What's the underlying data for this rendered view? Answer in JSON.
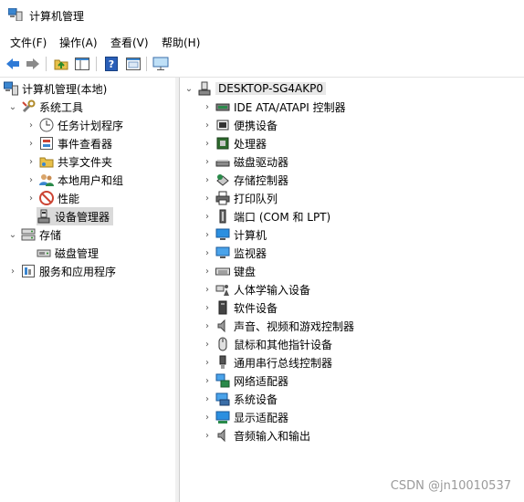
{
  "window": {
    "title": "计算机管理"
  },
  "menu": [
    "文件(F)",
    "操作(A)",
    "查看(V)",
    "帮助(H)"
  ],
  "toolbar": {
    "buttons": [
      "back-icon",
      "forward-icon",
      "up-folder-icon",
      "show-hide-tree-icon",
      "help-icon",
      "properties-icon",
      "monitor-icon"
    ]
  },
  "left_tree": {
    "root": "计算机管理(本地)",
    "system_tools": "系统工具",
    "task_scheduler": "任务计划程序",
    "event_viewer": "事件查看器",
    "shared_folders": "共享文件夹",
    "local_users": "本地用户和组",
    "performance": "性能",
    "device_manager": "设备管理器",
    "storage": "存储",
    "disk_management": "磁盘管理",
    "services_apps": "服务和应用程序"
  },
  "device_tree": {
    "computer_name": "DESKTOP-SG4AKP0",
    "categories": [
      "IDE ATA/ATAPI 控制器",
      "便携设备",
      "处理器",
      "磁盘驱动器",
      "存储控制器",
      "打印队列",
      "端口 (COM 和 LPT)",
      "计算机",
      "监视器",
      "键盘",
      "人体学输入设备",
      "软件设备",
      "声音、视频和游戏控制器",
      "鼠标和其他指针设备",
      "通用串行总线控制器",
      "网络适配器",
      "系统设备",
      "显示适配器",
      "音频输入和输出"
    ]
  },
  "watermark": "CSDN @jn10010537",
  "colors": {
    "accent": "#1f6fd1",
    "selection": "#dadada"
  }
}
